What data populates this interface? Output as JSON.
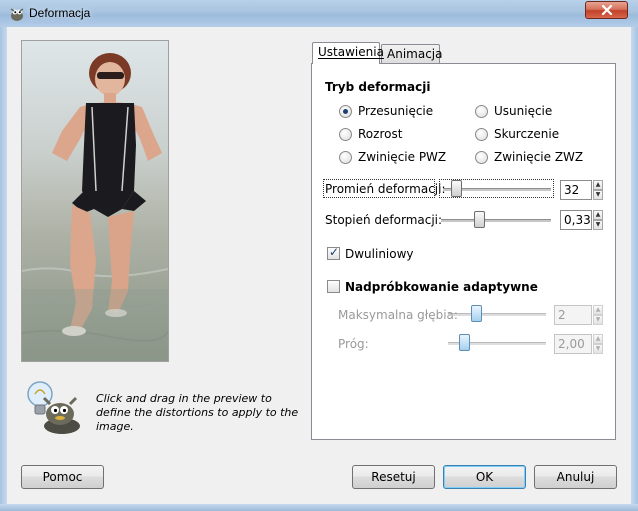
{
  "window": {
    "title": "Deformacja",
    "icon": "gimp-wilber-icon"
  },
  "tabs": [
    {
      "label": "Ustawienia",
      "active": true
    },
    {
      "label": "Animacja",
      "active": false
    }
  ],
  "mode": {
    "heading": "Tryb deformacji",
    "options": [
      {
        "label": "Przesunięcie",
        "checked": true
      },
      {
        "label": "Usunięcie",
        "checked": false
      },
      {
        "label": "Rozrost",
        "checked": false
      },
      {
        "label": "Skurczenie",
        "checked": false
      },
      {
        "label": "Zwinięcie PWZ",
        "checked": false
      },
      {
        "label": "Zwinięcie ZWZ",
        "checked": false
      }
    ]
  },
  "radius": {
    "label": "Promień deformacji:",
    "value": "32"
  },
  "amount": {
    "label": "Stopień deformacji:",
    "value": "0,33"
  },
  "bilinear": {
    "label": "Dwuliniowy",
    "checked": true
  },
  "adaptive": {
    "label": "Nadpróbkowanie adaptywne",
    "checked": false,
    "max_depth": {
      "label": "Maksymalna głębia:",
      "value": "2"
    },
    "threshold": {
      "label": "Próg:",
      "value": "2,00"
    }
  },
  "hint": "Click and drag in the preview to define the distortions to apply to the image.",
  "buttons": {
    "help": "Pomoc",
    "reset": "Resetuj",
    "ok": "OK",
    "cancel": "Anuluj"
  }
}
